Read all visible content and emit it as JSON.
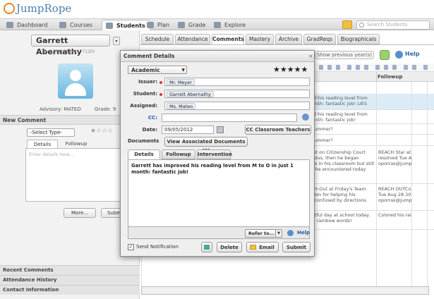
{
  "app": {
    "logo_text": "JumpRope"
  },
  "nav": {
    "tabs": [
      {
        "label": "Dashboard",
        "icon": "dashboard-icon"
      },
      {
        "label": "Courses",
        "icon": "courses-icon"
      },
      {
        "label": "Students",
        "icon": "students-icon"
      },
      {
        "label": "Plan",
        "icon": "plan-icon"
      },
      {
        "label": "Grade",
        "icon": "grade-icon"
      },
      {
        "label": "Explore",
        "icon": "explore-icon"
      }
    ],
    "active": "Students",
    "search_placeholder": "Search Students"
  },
  "student_panel": {
    "name": "Garrett Abernathy",
    "id_line": "ID: 223419594 (177120)",
    "advisory": "Advisory: MATEO",
    "grade": "Grade: 9",
    "new_comment_header": "New Comment",
    "select_type": "-Select Type-",
    "stars": "★☆☆☆",
    "tab_details": "Details",
    "tab_followup": "Followup",
    "details_placeholder": "Enter details here...",
    "more_button": "More...",
    "submit_button": "Submi",
    "sections": [
      "Recent Comments",
      "Attendance History",
      "Contact Information"
    ]
  },
  "right_tabs": [
    "Schedule",
    "Attendance",
    "Comments",
    "Mastery",
    "Archive",
    "GradReqs",
    "Biographicals"
  ],
  "right_tabs_active": "Comments",
  "comments_panel": {
    "show_previous": "Show previous year(s)",
    "help": "Help",
    "followup_header": "Followup",
    "rows": [
      {
        "text": "ved his reading level from\nmonth: fantastic job! LIES",
        "followup": ""
      },
      {
        "text": "ved his reading level from\nmonth: fantastic job!",
        "followup": ""
      },
      {
        "text": "s summer?",
        "followup": ""
      },
      {
        "text": "s summer?",
        "followup": ""
      },
      {
        "text": "spot on Citizenship Court\nPaulus, then he began\nings in his classroom but still\nult he encountered today",
        "followup": "REACH Star at\nresolved Tue A\noporras@jump"
      },
      {
        "text": "ACH-Out at Friday's Team\nration for helping his\nas confused by directions",
        "followup": "REACH OUTCo\nTue Aug 28 20\noporras@jump"
      },
      {
        "text": "ightful day at school today.\nred rainbow words!",
        "followup": "Colored his rai"
      }
    ]
  },
  "modal": {
    "title": "Comment Details",
    "close": "×",
    "category": "Academic",
    "stars": "★★★★★",
    "issuer_label": "Issuer:",
    "issuer": "Mr. Meyer",
    "student_label": "Student:",
    "student": "Garrett Abernathy",
    "assigned_label": "Assigned:",
    "assigned": "Ms. Mateo",
    "cc_label": "CC:",
    "date_label": "Date:",
    "date": "09/05/2012",
    "cc_teachers_button": "CC Classroom Teachers",
    "documents_label": "Documents",
    "view_docs_button": "View Associated Documents (0)",
    "tabs": [
      "Details",
      "Followup",
      "Intervention"
    ],
    "active_tab": "Details",
    "details_text": "Garrett has improved his reading level from M to O in just 1 month: fantastic job!",
    "refer_to": "Refer to...",
    "help": "Help",
    "send_notification_label": "Send Notification",
    "send_notification_checked": "✓",
    "delete_button": "Delete",
    "email_button": "Email",
    "submit_button": "Submit"
  }
}
